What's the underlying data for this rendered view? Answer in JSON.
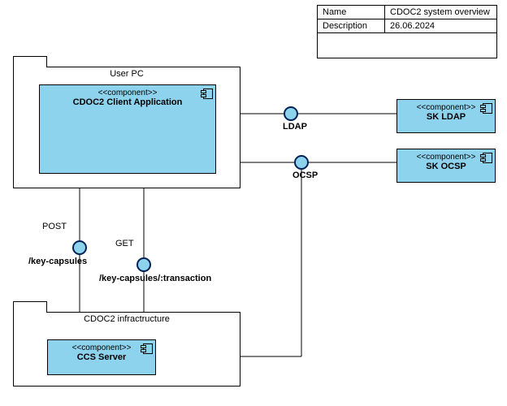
{
  "meta": {
    "name_label": "Name",
    "name_value": "CDOC2 system overview",
    "desc_label": "Description",
    "desc_value": "26.06.2024"
  },
  "packages": {
    "user_pc": {
      "title": "User PC"
    },
    "infra": {
      "title": "CDOC2 infractructure"
    }
  },
  "components": {
    "client": {
      "stereo": "<<component>>",
      "name": "CDOC2 Client Application"
    },
    "ccs": {
      "stereo": "<<component>>",
      "name": "CCS Server"
    },
    "sk_ldap": {
      "stereo": "<<component>>",
      "name": "SK LDAP"
    },
    "sk_ocsp": {
      "stereo": "<<component>>",
      "name": "SK OCSP"
    }
  },
  "interfaces": {
    "ldap": {
      "label": "LDAP"
    },
    "ocsp": {
      "label": "OCSP"
    },
    "post": {
      "method": "POST",
      "path": "/key-capsules"
    },
    "get": {
      "method": "GET",
      "path": "/key-capsules/:transaction"
    }
  }
}
